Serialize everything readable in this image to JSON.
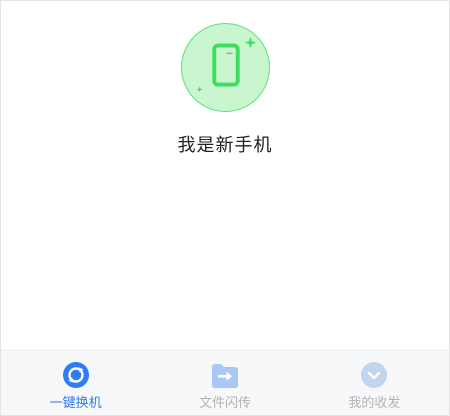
{
  "screen": {
    "title": "我是新手机",
    "icon": "phone-icon",
    "accent": "#5fe07a"
  },
  "tabbar": {
    "active_color": "#2e7cf6",
    "inactive_color": "#b3b3b3",
    "tabs": [
      {
        "label": "一键换机",
        "icon": "phone-switch-icon",
        "active": true
      },
      {
        "label": "文件闪传",
        "icon": "file-transfer-icon",
        "active": false
      },
      {
        "label": "我的收发",
        "icon": "my-transfers-icon",
        "active": false
      }
    ]
  }
}
